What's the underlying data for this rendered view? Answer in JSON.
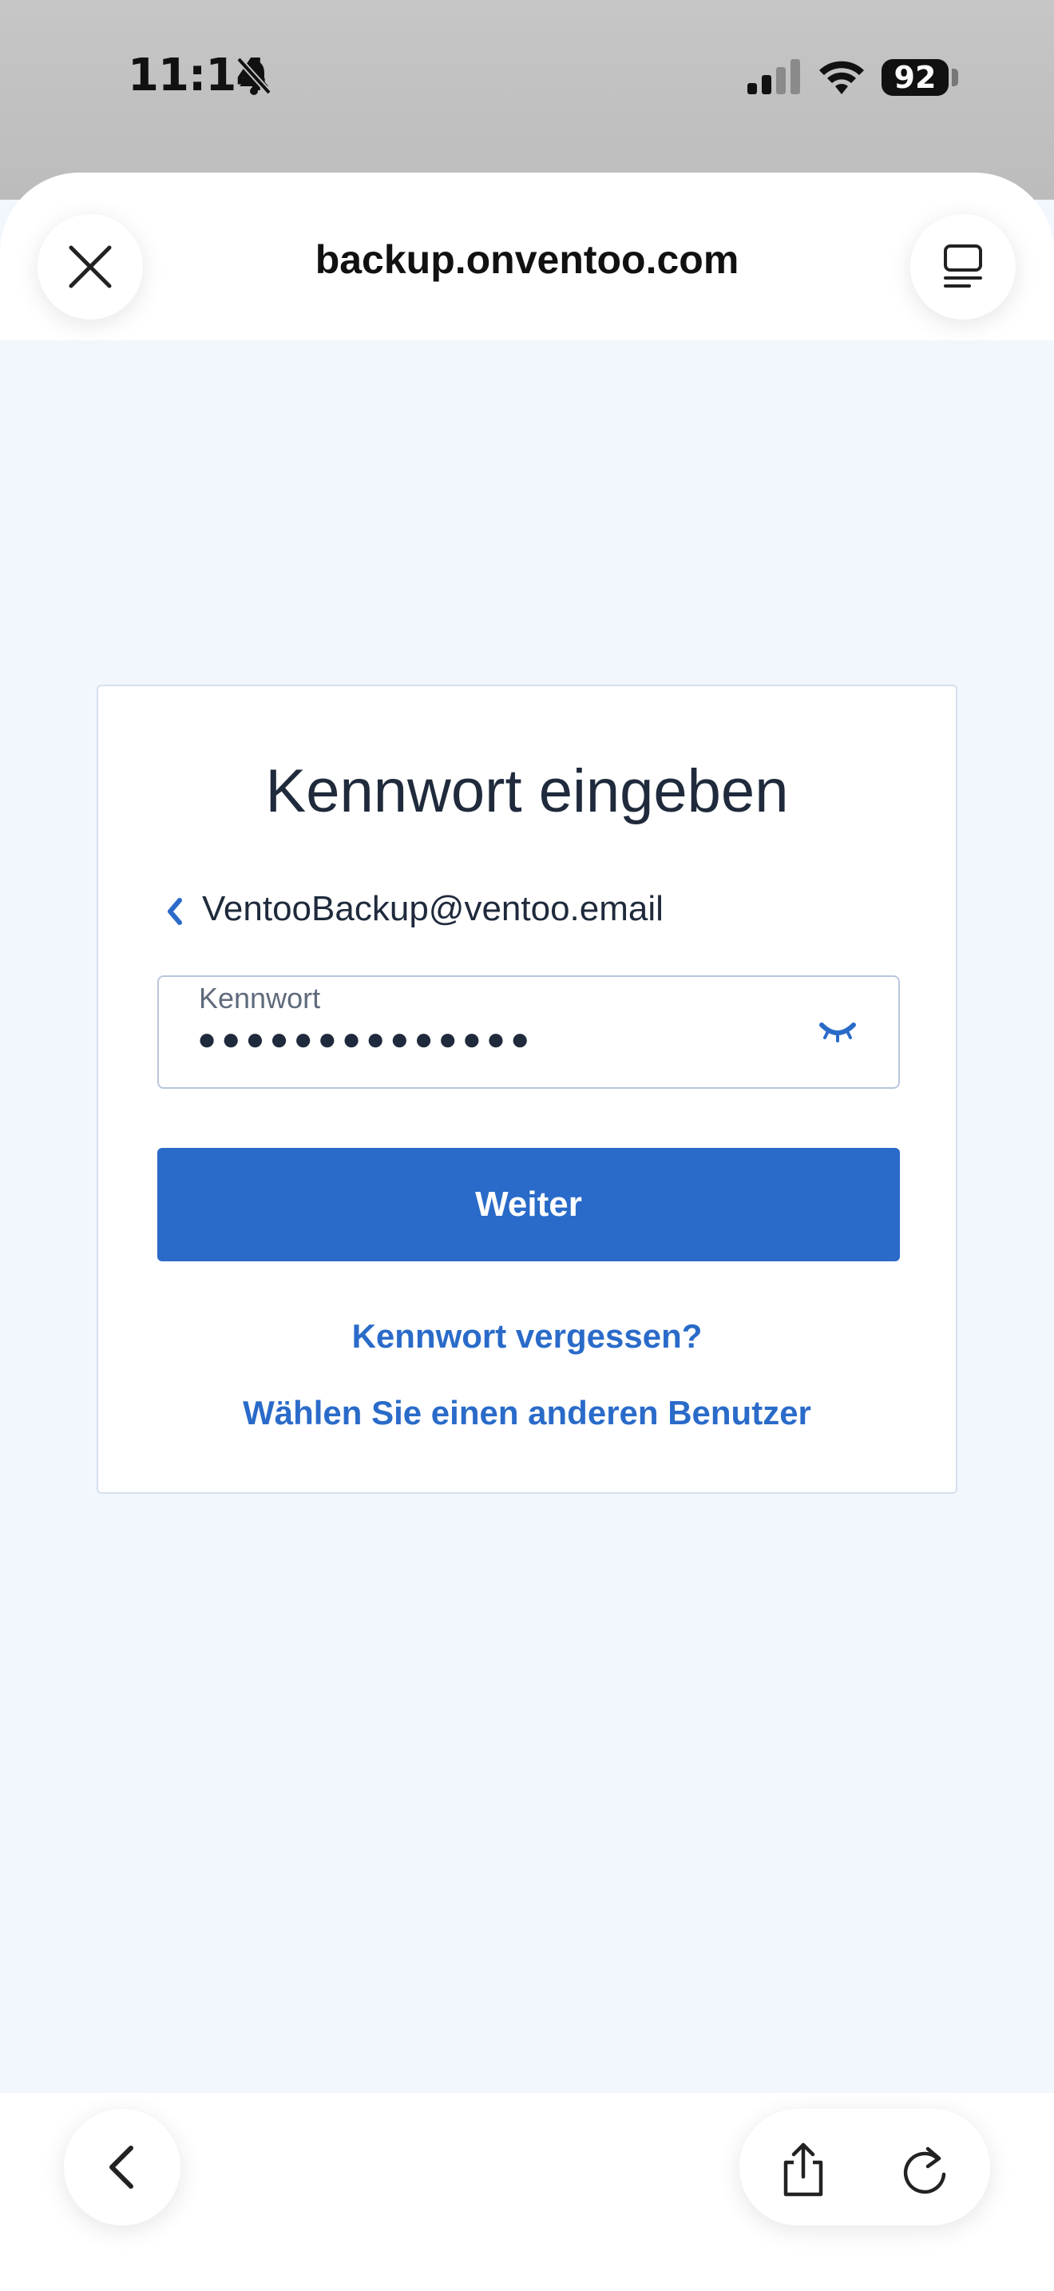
{
  "status_bar": {
    "time": "11:14",
    "battery": "92"
  },
  "browser": {
    "url": "backup.onventoo.com"
  },
  "login_card": {
    "title": "Kennwort eingeben",
    "account_email": "VentooBackup@ventoo.email",
    "password_label": "Kennwort",
    "password_masked": "●●●●●●●●●●●●●●",
    "submit_label": "Weiter",
    "forgot_password_link": "Kennwort vergessen?",
    "other_user_link": "Wählen Sie einen anderen Benutzer"
  },
  "colors": {
    "accent": "#2a6bc9",
    "page_background": "#f2f6fd",
    "text": "#1f2a3c"
  },
  "icons": {
    "close": "close-icon",
    "tabs": "tab-overview-icon",
    "back": "chevron-left-icon",
    "share": "share-icon",
    "reload": "reload-icon",
    "password_toggle": "eye-closed-icon",
    "account_back": "chevron-left-icon"
  }
}
